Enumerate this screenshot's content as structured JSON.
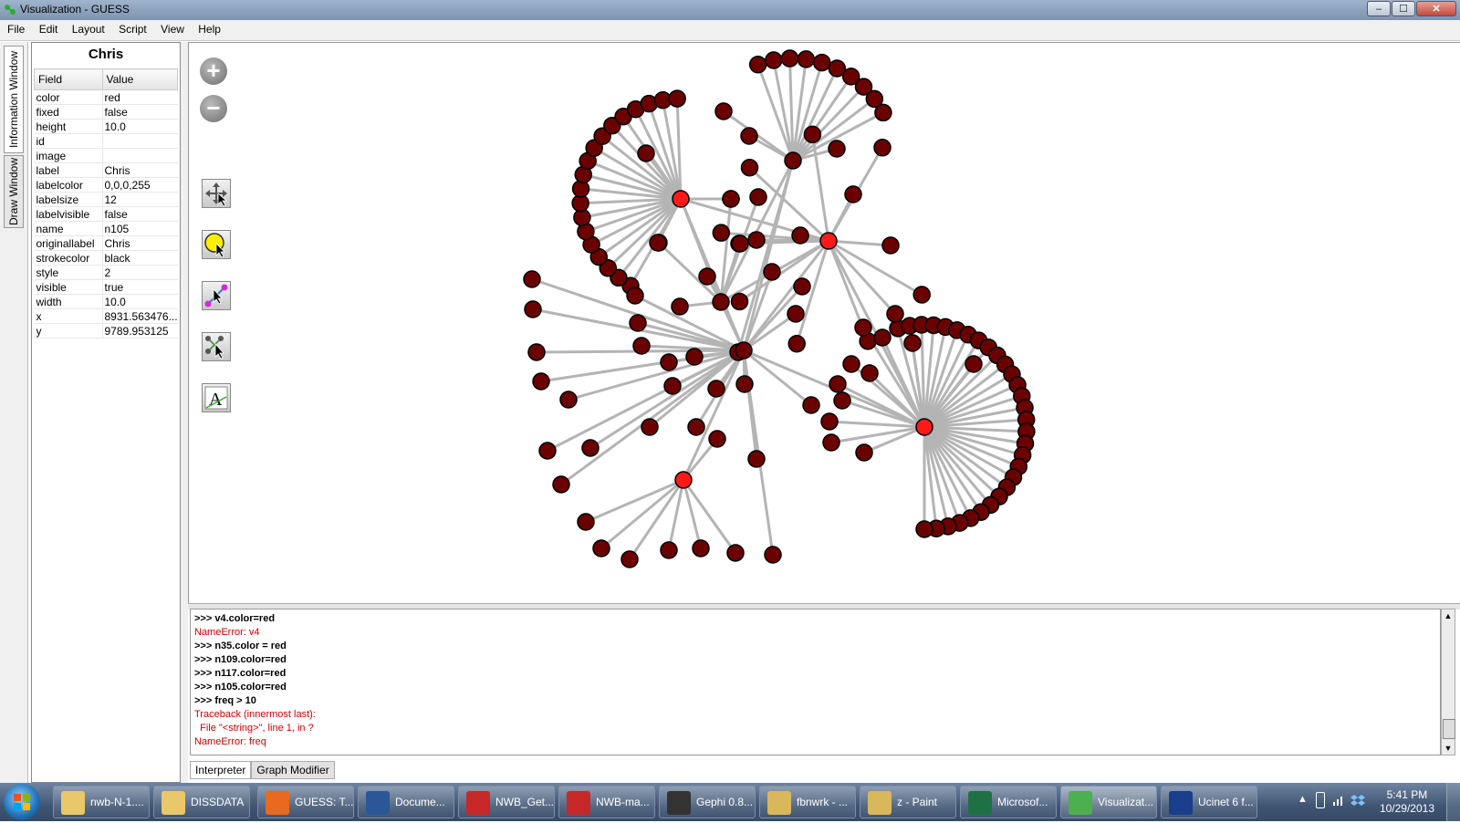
{
  "window": {
    "title": "Visualization - GUESS",
    "min": "–",
    "max": "☐",
    "close": "✕"
  },
  "menu": [
    "File",
    "Edit",
    "Layout",
    "Script",
    "View",
    "Help"
  ],
  "side_tabs": [
    "Information Window",
    "Draw Window"
  ],
  "info": {
    "title": "Chris",
    "headers": [
      "Field",
      "Value"
    ],
    "rows": [
      [
        "color",
        "red"
      ],
      [
        "fixed",
        "false"
      ],
      [
        "height",
        "10.0"
      ],
      [
        "id",
        ""
      ],
      [
        "image",
        ""
      ],
      [
        "label",
        "Chris"
      ],
      [
        "labelcolor",
        "0,0,0,255"
      ],
      [
        "labelsize",
        "12"
      ],
      [
        "labelvisible",
        "false"
      ],
      [
        "name",
        "n105"
      ],
      [
        "originallabel",
        "Chris"
      ],
      [
        "strokecolor",
        "black"
      ],
      [
        "style",
        "2"
      ],
      [
        "visible",
        "true"
      ],
      [
        "width",
        "10.0"
      ],
      [
        "x",
        "8931.563476..."
      ],
      [
        "y",
        "9789.953125"
      ]
    ]
  },
  "tools": [
    "zoom-in-icon",
    "zoom-out-icon",
    "move-tool-icon",
    "select-tool-icon",
    "node-edge-tool-icon",
    "multi-select-tool-icon",
    "text-tool-icon"
  ],
  "graph": {
    "edge_color": "#b4b4b4",
    "node_color": "#6b0000",
    "highlight_color": "#ff1a1a"
  },
  "console": {
    "lines": [
      {
        "t": ">>> v4.color=red",
        "k": "in"
      },
      {
        "t": "NameError: v4",
        "k": "err"
      },
      {
        "t": ">>> n35.color = red",
        "k": "in"
      },
      {
        "t": ">>> n109.color=red",
        "k": "in"
      },
      {
        "t": ">>> n117.color=red",
        "k": "in"
      },
      {
        "t": ">>> n105.color=red",
        "k": "in"
      },
      {
        "t": ">>> freq > 10",
        "k": "in"
      },
      {
        "t": "Traceback (innermost last):",
        "k": "err"
      },
      {
        "t": "  File \"<string>\", line 1, in ?",
        "k": "err"
      },
      {
        "t": "NameError: freq",
        "k": "err"
      }
    ]
  },
  "bottom_tabs": [
    "Interpreter",
    "Graph Modifier"
  ],
  "taskbar": {
    "items": [
      {
        "label": "nwb-N-1....",
        "color": "#e8c86a"
      },
      {
        "label": "DISSDATA",
        "color": "#e8c86a"
      },
      {
        "label": "GUESS: T...",
        "color": "#e86a1f"
      },
      {
        "label": "Docume...",
        "color": "#2b5797"
      },
      {
        "label": "NWB_Get...",
        "color": "#c62828"
      },
      {
        "label": "NWB-ma...",
        "color": "#c62828"
      },
      {
        "label": "Gephi 0.8...",
        "color": "#333333"
      },
      {
        "label": "fbnwrk - ...",
        "color": "#d9b85c"
      },
      {
        "label": "z - Paint",
        "color": "#d9b85c"
      },
      {
        "label": "Microsof...",
        "color": "#1e7145"
      },
      {
        "label": "Visualizat...",
        "color": "#4caf50"
      },
      {
        "label": "Ucinet 6 f...",
        "color": "#1a3e8c"
      }
    ],
    "time": "5:41 PM",
    "date": "10/29/2013"
  }
}
